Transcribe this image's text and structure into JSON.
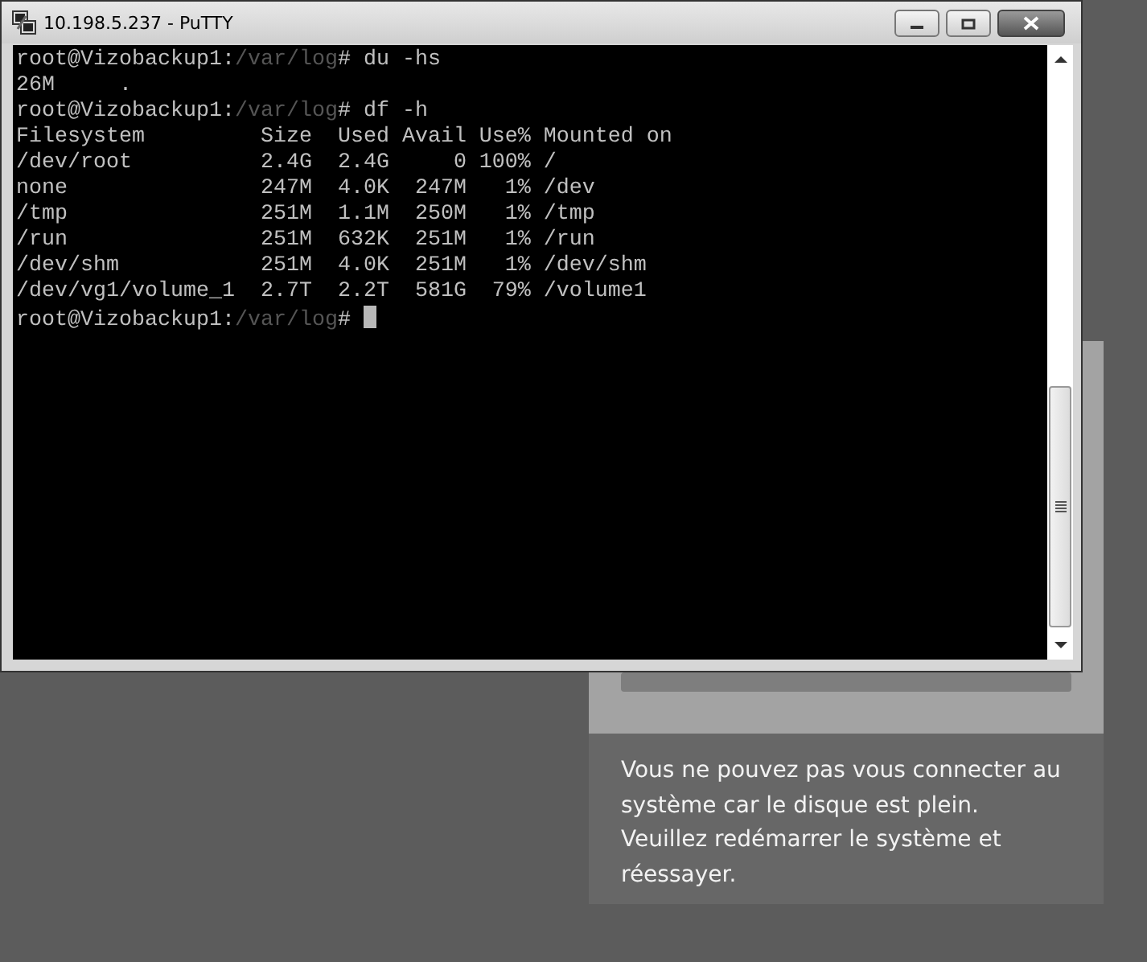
{
  "window": {
    "title": "10.198.5.237 - PuTTY"
  },
  "terminal": {
    "lines": [
      {
        "kind": "prompt",
        "host": "root@Vizobackup1:",
        "path": "/var/log",
        "symbol": "#",
        "command": "du -hs",
        "cursor": false
      },
      {
        "kind": "output",
        "text": "26M     ."
      },
      {
        "kind": "prompt",
        "host": "root@Vizobackup1:",
        "path": "/var/log",
        "symbol": "#",
        "command": "df -h",
        "cursor": false
      },
      {
        "kind": "output",
        "text": "Filesystem         Size  Used Avail Use% Mounted on"
      },
      {
        "kind": "output",
        "text": "/dev/root          2.4G  2.4G     0 100% /"
      },
      {
        "kind": "output",
        "text": "none               247M  4.0K  247M   1% /dev"
      },
      {
        "kind": "output",
        "text": "/tmp               251M  1.1M  250M   1% /tmp"
      },
      {
        "kind": "output",
        "text": "/run               251M  632K  251M   1% /run"
      },
      {
        "kind": "output",
        "text": "/dev/shm           251M  4.0K  251M   1% /dev/shm"
      },
      {
        "kind": "output",
        "text": "/dev/vg1/volume_1  2.7T  2.2T  581G  79% /volume1"
      },
      {
        "kind": "prompt",
        "host": "root@Vizobackup1:",
        "path": "/var/log",
        "symbol": "#",
        "cursor": true
      }
    ]
  },
  "message": {
    "text": "Vous ne pouvez pas vous connecter au système car le disque est plein. Veuillez redémarrer le système et réessayer."
  }
}
